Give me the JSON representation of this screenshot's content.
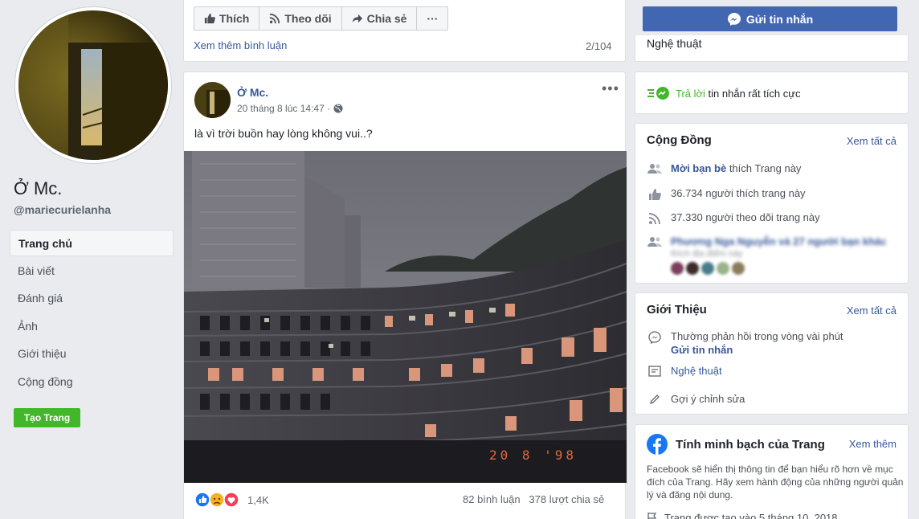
{
  "profile": {
    "name": "Ở Mc.",
    "handle": "@mariecurielanha"
  },
  "nav": {
    "items": [
      "Trang chủ",
      "Bài viết",
      "Đánh giá",
      "Ảnh",
      "Giới thiệu",
      "Cộng đồng"
    ],
    "create_label": "Tạo Trang"
  },
  "top_actions": {
    "like": "Thích",
    "follow": "Theo dõi",
    "share": "Chia sẻ",
    "more": "···",
    "see_more_comments": "Xem thêm bình luận",
    "comment_counter": "2/104"
  },
  "post": {
    "author": "Ở Mc.",
    "time": "20 tháng 8 lúc 14:47 ·",
    "text": "là vì trời buồn hay lòng không vui..?",
    "photo_stamp": "20 8 '98",
    "reaction_count": "1,4K",
    "comments": "82 bình luận",
    "shares": "378 lượt chia sẻ"
  },
  "right": {
    "message_button": "Gửi tin nhắn",
    "category_top": "Nghệ thuật",
    "responsive_green": "Trả lời",
    "responsive_rest": " tin nhắn rất tích cực",
    "community": {
      "title": "Cộng Đồng",
      "see_all": "Xem tất cả",
      "invite_link": "Mời bạn bè",
      "invite_rest": " thích Trang này",
      "likes": "36.734 người thích trang này",
      "follows": "37.330 người theo dõi trang này",
      "friends_line": "Phương Nga Nguyễn và 27 người bạn khác",
      "friends_sub": "thích địa điểm này"
    },
    "about": {
      "title": "Giới Thiệu",
      "see_all": "Xem tất cả",
      "response": "Thường phản hồi trong vòng vài phút",
      "send_message": "Gửi tin nhắn",
      "category": "Nghệ thuật",
      "suggest": "Gợi ý chỉnh sửa"
    },
    "transparency": {
      "title": "Tính minh bạch của Trang",
      "see_more": "Xem thêm",
      "desc": "Facebook sẽ hiển thị thông tin để bạn hiểu rõ hơn về mục đích của Trang. Hãy xem hành động của những người quản lý và đăng nội dung.",
      "created": "Trang được tạo vào 5 tháng 10, 2018"
    }
  },
  "colors": {
    "fb_blue": "#4267b2",
    "link": "#385898",
    "green": "#42b72a",
    "background": "#e9ebee"
  }
}
